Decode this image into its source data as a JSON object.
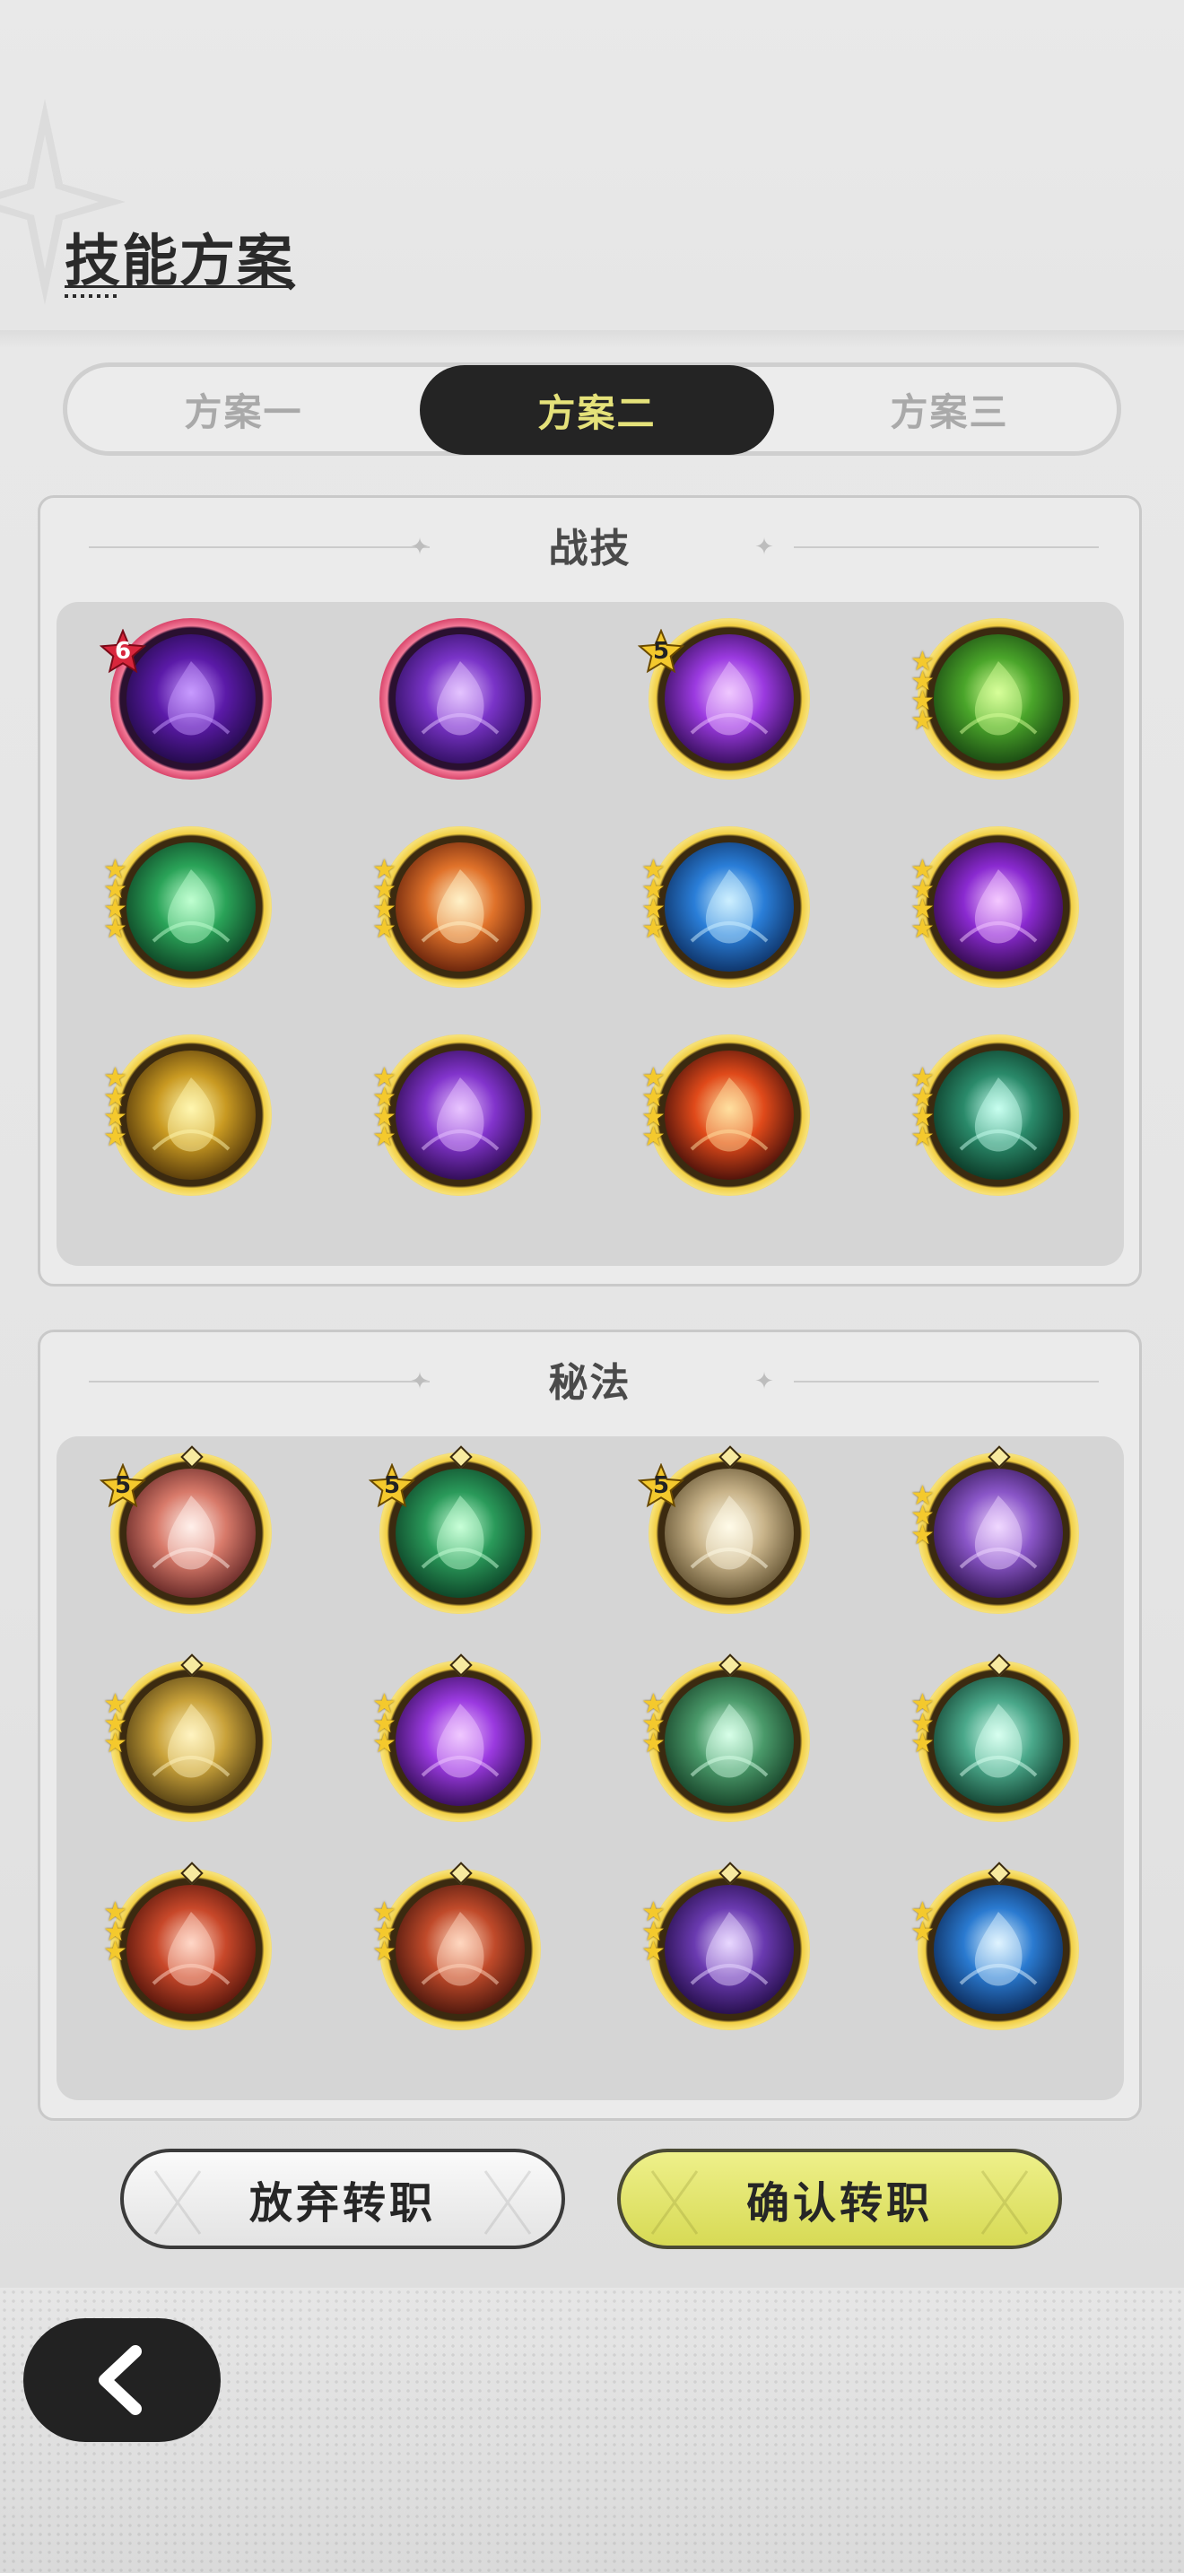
{
  "header": {
    "title": "技能方案"
  },
  "tabs": [
    {
      "label": "方案一",
      "active": false
    },
    {
      "label": "方案二",
      "active": true
    },
    {
      "label": "方案三",
      "active": false
    }
  ],
  "panels": [
    {
      "title": "战技",
      "skills": [
        {
          "level": "6",
          "stars": 0,
          "frame": "red",
          "theme": "violet"
        },
        {
          "level": "",
          "stars": 0,
          "frame": "red",
          "theme": "violet-swirl"
        },
        {
          "level": "5",
          "stars": 0,
          "frame": "gold",
          "theme": "violet-eye"
        },
        {
          "level": "",
          "stars": 4,
          "frame": "gold",
          "theme": "green-stump"
        },
        {
          "level": "",
          "stars": 4,
          "frame": "gold",
          "theme": "green-flame"
        },
        {
          "level": "",
          "stars": 4,
          "frame": "gold",
          "theme": "orange-beast"
        },
        {
          "level": "",
          "stars": 4,
          "frame": "gold",
          "theme": "blue-ghost"
        },
        {
          "level": "",
          "stars": 4,
          "frame": "gold",
          "theme": "violet-diamond"
        },
        {
          "level": "",
          "stars": 4,
          "frame": "gold",
          "theme": "gold-cross"
        },
        {
          "level": "",
          "stars": 4,
          "frame": "gold",
          "theme": "violet-hand"
        },
        {
          "level": "",
          "stars": 4,
          "frame": "gold",
          "theme": "red-fire"
        },
        {
          "level": "",
          "stars": 4,
          "frame": "gold",
          "theme": "teal-thorn"
        }
      ]
    },
    {
      "title": "秘法",
      "skills": [
        {
          "level": "5",
          "stars": 0,
          "frame": "gold",
          "theme": "pink-wave"
        },
        {
          "level": "5",
          "stars": 0,
          "frame": "gold",
          "theme": "green-cross"
        },
        {
          "level": "5",
          "stars": 0,
          "frame": "gold",
          "theme": "beige-arrow"
        },
        {
          "level": "",
          "stars": 3,
          "frame": "gold",
          "theme": "violet-fist"
        },
        {
          "level": "",
          "stars": 3,
          "frame": "gold",
          "theme": "gold-bird"
        },
        {
          "level": "",
          "stars": 3,
          "frame": "gold",
          "theme": "violet-eye"
        },
        {
          "level": "",
          "stars": 3,
          "frame": "gold",
          "theme": "green-burst"
        },
        {
          "level": "",
          "stars": 3,
          "frame": "gold",
          "theme": "teal-leaf"
        },
        {
          "level": "",
          "stars": 3,
          "frame": "gold",
          "theme": "red-figure"
        },
        {
          "level": "",
          "stars": 3,
          "frame": "gold",
          "theme": "red-fist"
        },
        {
          "level": "",
          "stars": 3,
          "frame": "gold",
          "theme": "violet-figure"
        },
        {
          "level": "",
          "stars": 2,
          "frame": "gold",
          "theme": "blue-shard"
        }
      ]
    }
  ],
  "buttons": {
    "abandon": "放弃转职",
    "confirm": "确认转职"
  },
  "icons": {
    "back": "back-arrow-icon",
    "divider": "sparkle-icon",
    "star": "star-icon"
  },
  "colors": {
    "active_tab_bg": "#242424",
    "active_tab_text": "#e5e27a",
    "confirm_bg": "#d7da55"
  }
}
